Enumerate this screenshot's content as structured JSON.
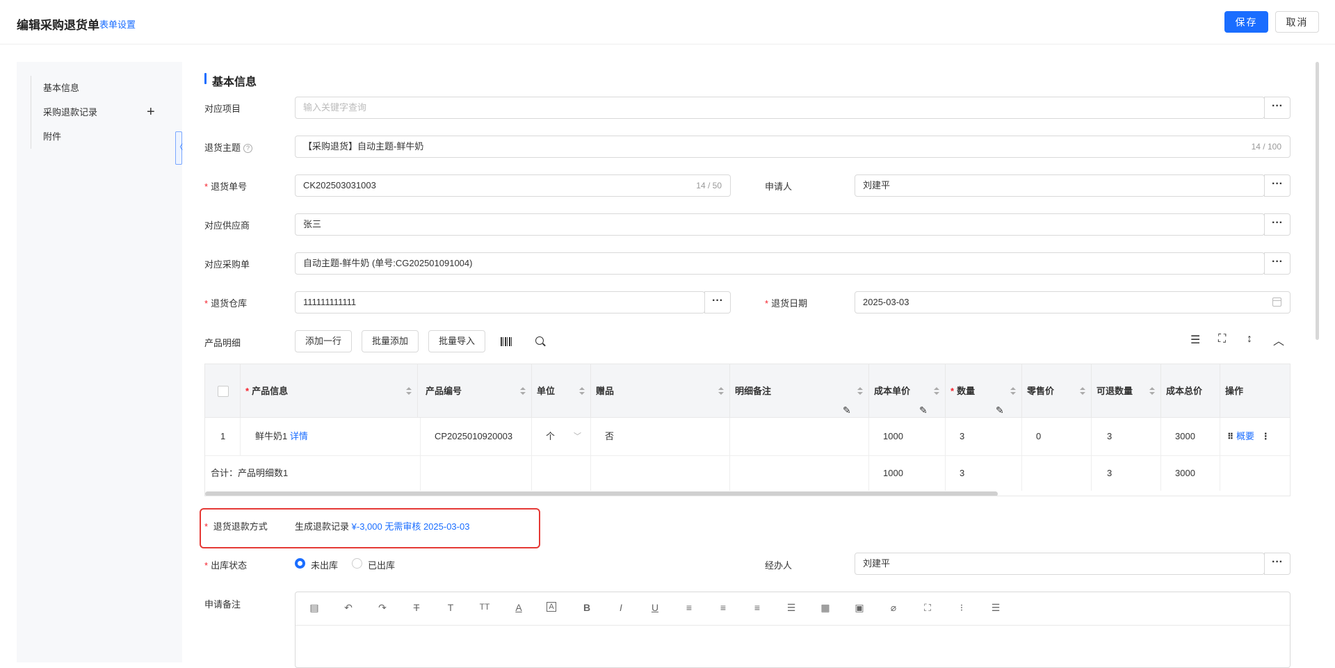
{
  "header": {
    "title": "编辑采购退货单",
    "form_settings": "表单设置",
    "save": "保存",
    "cancel": "取消"
  },
  "sidebar": {
    "items": [
      {
        "label": "基本信息"
      },
      {
        "label": "采购退款记录"
      },
      {
        "label": "附件"
      }
    ],
    "plus": "+",
    "collapse_glyph": "〈"
  },
  "section": {
    "title": "基本信息"
  },
  "form": {
    "project": {
      "label": "对应项目",
      "placeholder": "输入关键字查询"
    },
    "subject": {
      "label": "退货主题",
      "value": "【采购退货】自动主题-鲜牛奶",
      "count": "14 / 100"
    },
    "return_no": {
      "label": "退货单号",
      "value": "CK202503031003",
      "count": "14 / 50"
    },
    "applicant": {
      "label": "申请人",
      "value": "刘建平"
    },
    "supplier": {
      "label": "对应供应商",
      "value": "张三"
    },
    "purchase_order": {
      "label": "对应采购单",
      "value": "自动主题-鲜牛奶 (单号:CG202501091004)"
    },
    "warehouse": {
      "label": "退货仓库",
      "value": "111111111111"
    },
    "return_date": {
      "label": "退货日期",
      "value": "2025-03-03"
    },
    "product_detail": {
      "label": "产品明细",
      "add_row": "添加一行",
      "batch_add": "批量添加",
      "batch_import": "批量导入"
    },
    "refund_method": {
      "label": "退货退款方式",
      "text": "生成退款记录",
      "link": "¥-3,000 无需审核 2025-03-03"
    },
    "outbound_status": {
      "label": "出库状态",
      "options": [
        "未出库",
        "已出库"
      ],
      "selected": "未出库"
    },
    "handler": {
      "label": "经办人",
      "value": "刘建平"
    },
    "remark": {
      "label": "申请备注"
    },
    "ellipsis": "···",
    "help_glyph": "?"
  },
  "table": {
    "columns": [
      "产品信息",
      "产品编号",
      "单位",
      "赠品",
      "明细备注",
      "成本单价",
      "数量",
      "零售价",
      "可退数量",
      "成本总价",
      "操作"
    ],
    "row": {
      "index": "1",
      "product": "鲜牛奶1",
      "detail_link": "详情",
      "code": "CP2025010920003",
      "unit": "个",
      "gift": "否",
      "remark": "",
      "cost_price": "1000",
      "qty": "3",
      "retail": "0",
      "returnable": "3",
      "total": "3000",
      "op_link": "概要"
    },
    "summary": {
      "label": "合计：产品明细数1",
      "cost_price": "1000",
      "qty": "3",
      "returnable": "3",
      "total": "3000"
    }
  }
}
